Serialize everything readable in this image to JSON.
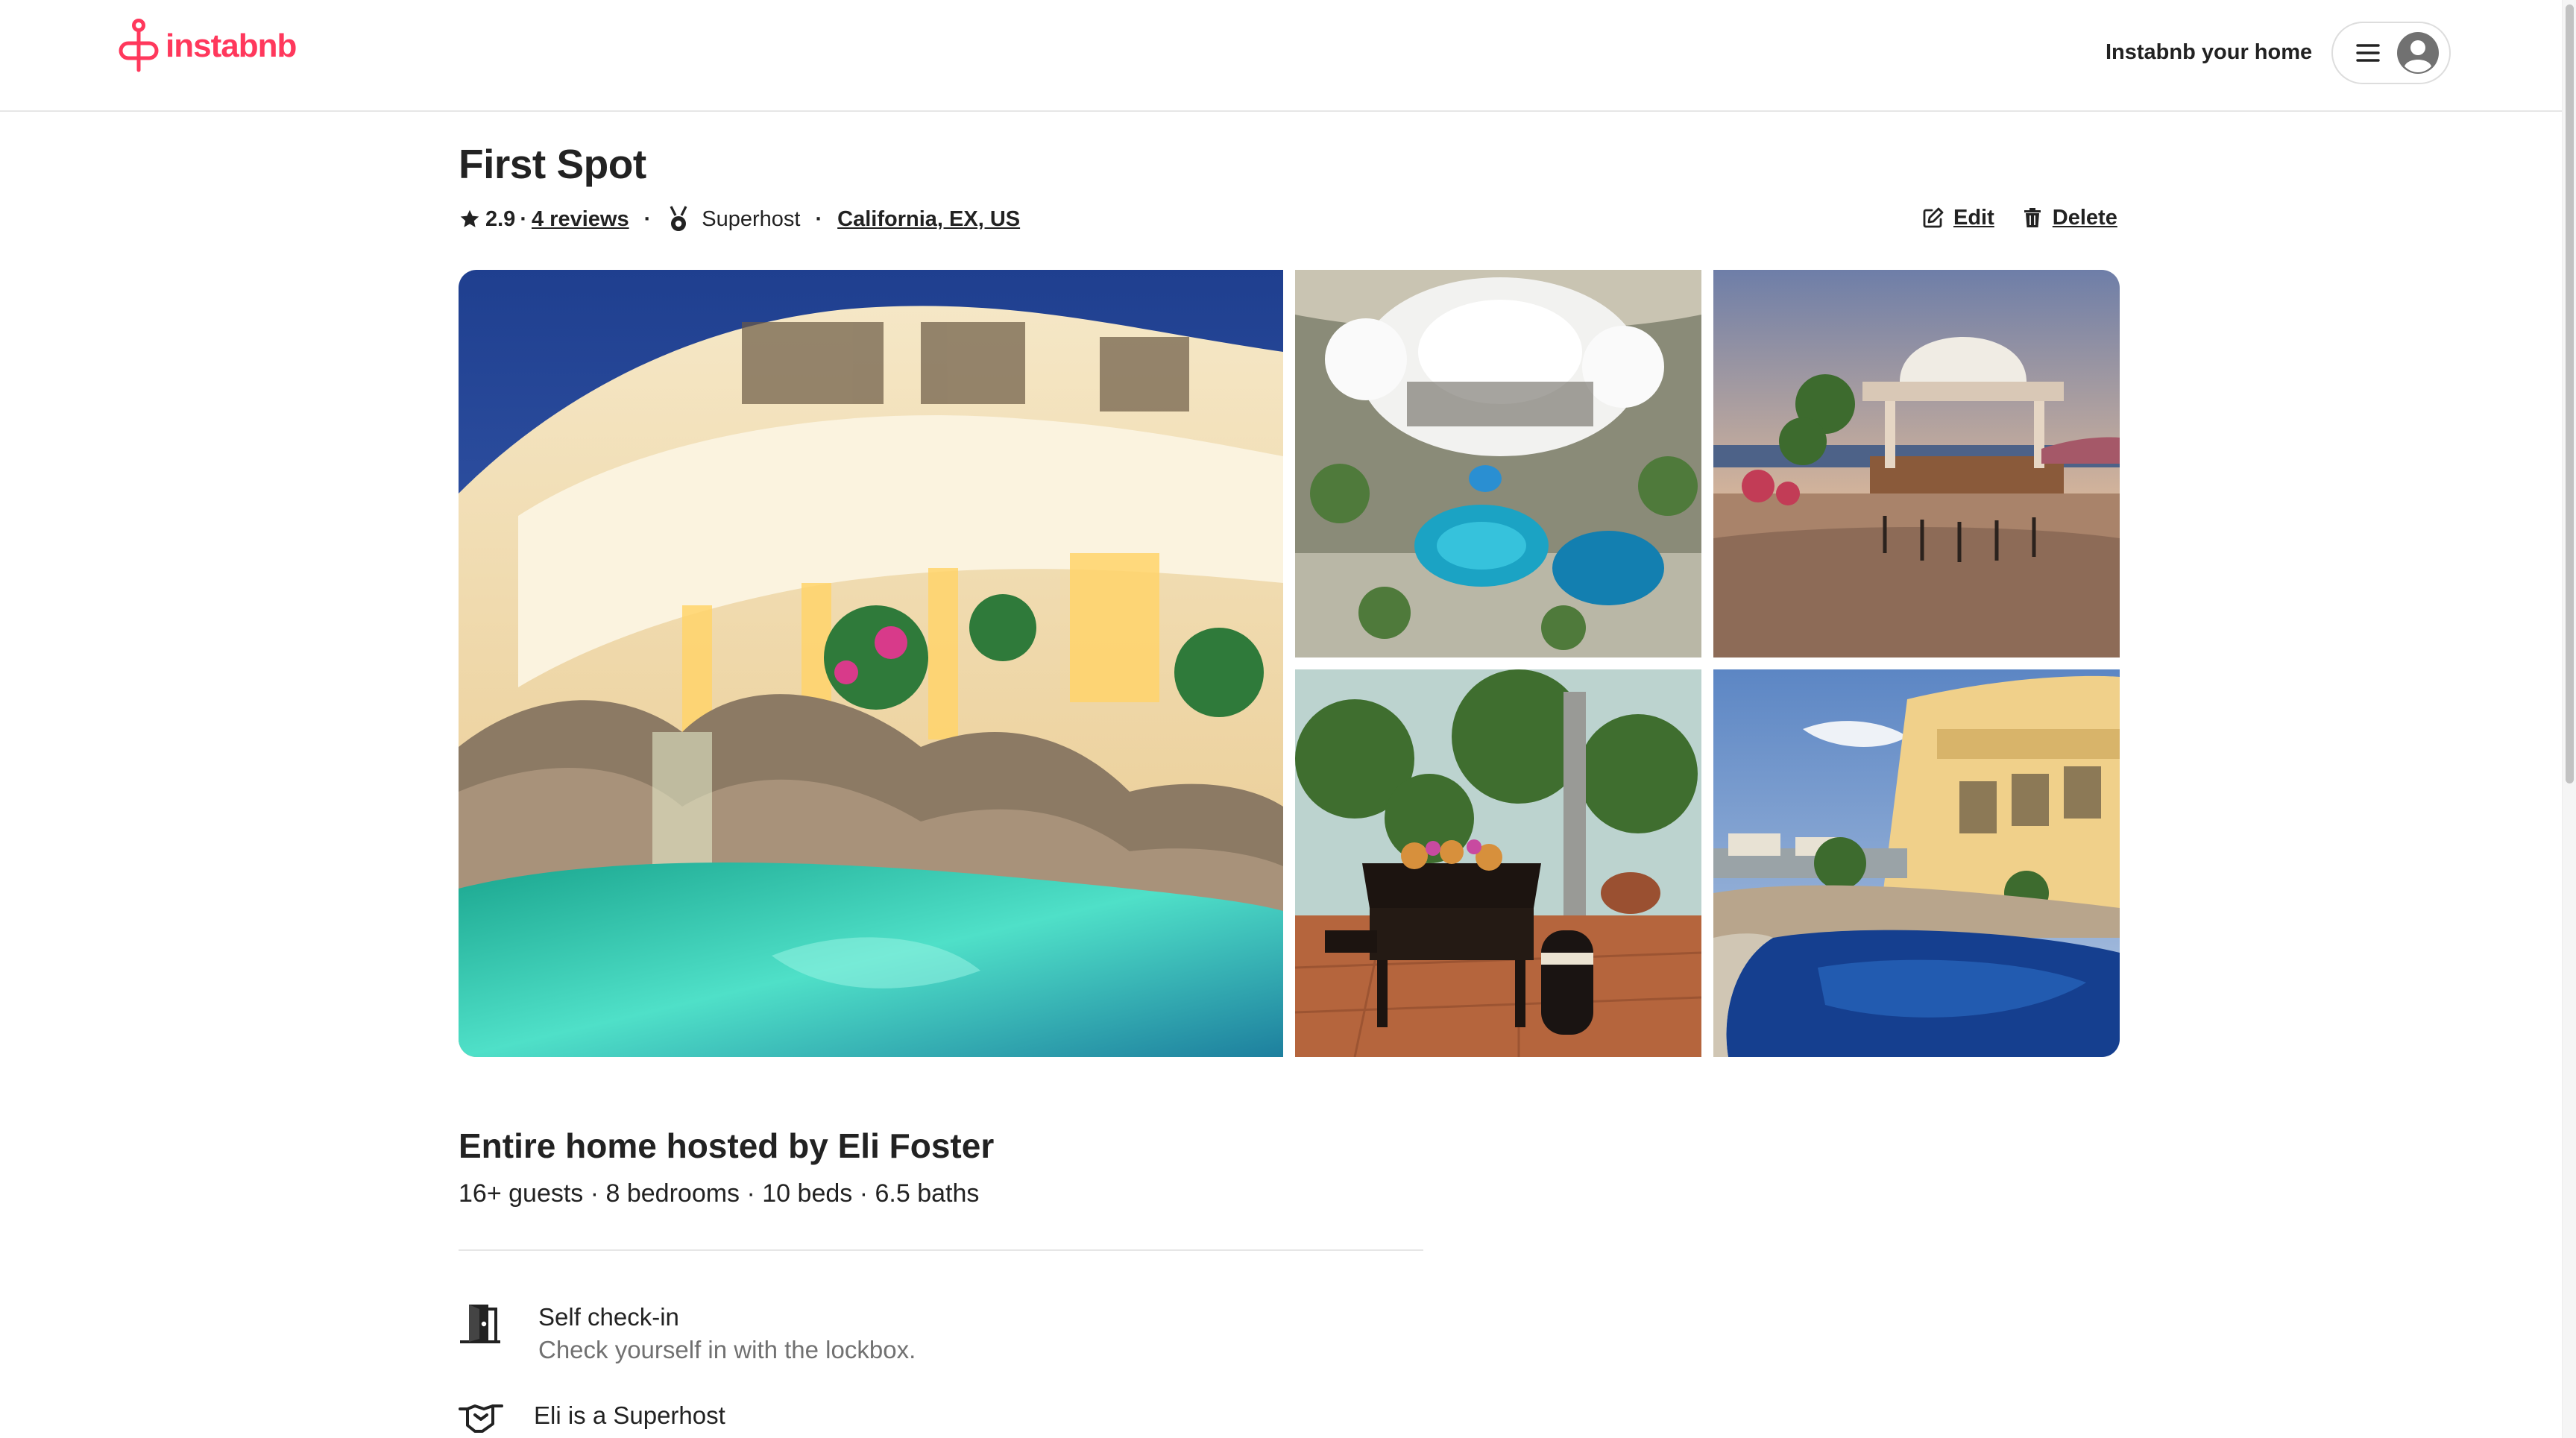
{
  "header": {
    "logo_text": "instabnb",
    "brand_color": "#ff385c",
    "host_link": "Instabnb your home",
    "menu_icon": "hamburger-icon",
    "avatar_icon": "user-avatar-icon"
  },
  "listing": {
    "title": "First Spot",
    "rating": "2.9",
    "rating_separator": "·",
    "reviews_link": "4 reviews",
    "separator": "·",
    "superhost_badge": "Superhost",
    "location": "California, EX, US",
    "actions": {
      "edit_label": "Edit",
      "delete_label": "Delete"
    }
  },
  "photos": [
    {
      "name": "villa-exterior-waterfall-pool",
      "icon": "photo"
    },
    {
      "name": "aerial-view-villa-pools",
      "icon": "photo"
    },
    {
      "name": "sunset-terrace-bar",
      "icon": "photo"
    },
    {
      "name": "grand-piano-room",
      "icon": "photo"
    },
    {
      "name": "villa-pool-daytime",
      "icon": "photo"
    }
  ],
  "details": {
    "hosted_by": "Entire home hosted by Eli Foster",
    "capacity": "16+ guests · 8 bedrooms · 10 beds · 6.5 baths"
  },
  "features": [
    {
      "icon": "door-icon",
      "title": "Self check-in",
      "description": "Check yourself in with the lockbox."
    },
    {
      "icon": "handshake-icon",
      "title": "Eli is a Superhost",
      "description": ""
    }
  ]
}
